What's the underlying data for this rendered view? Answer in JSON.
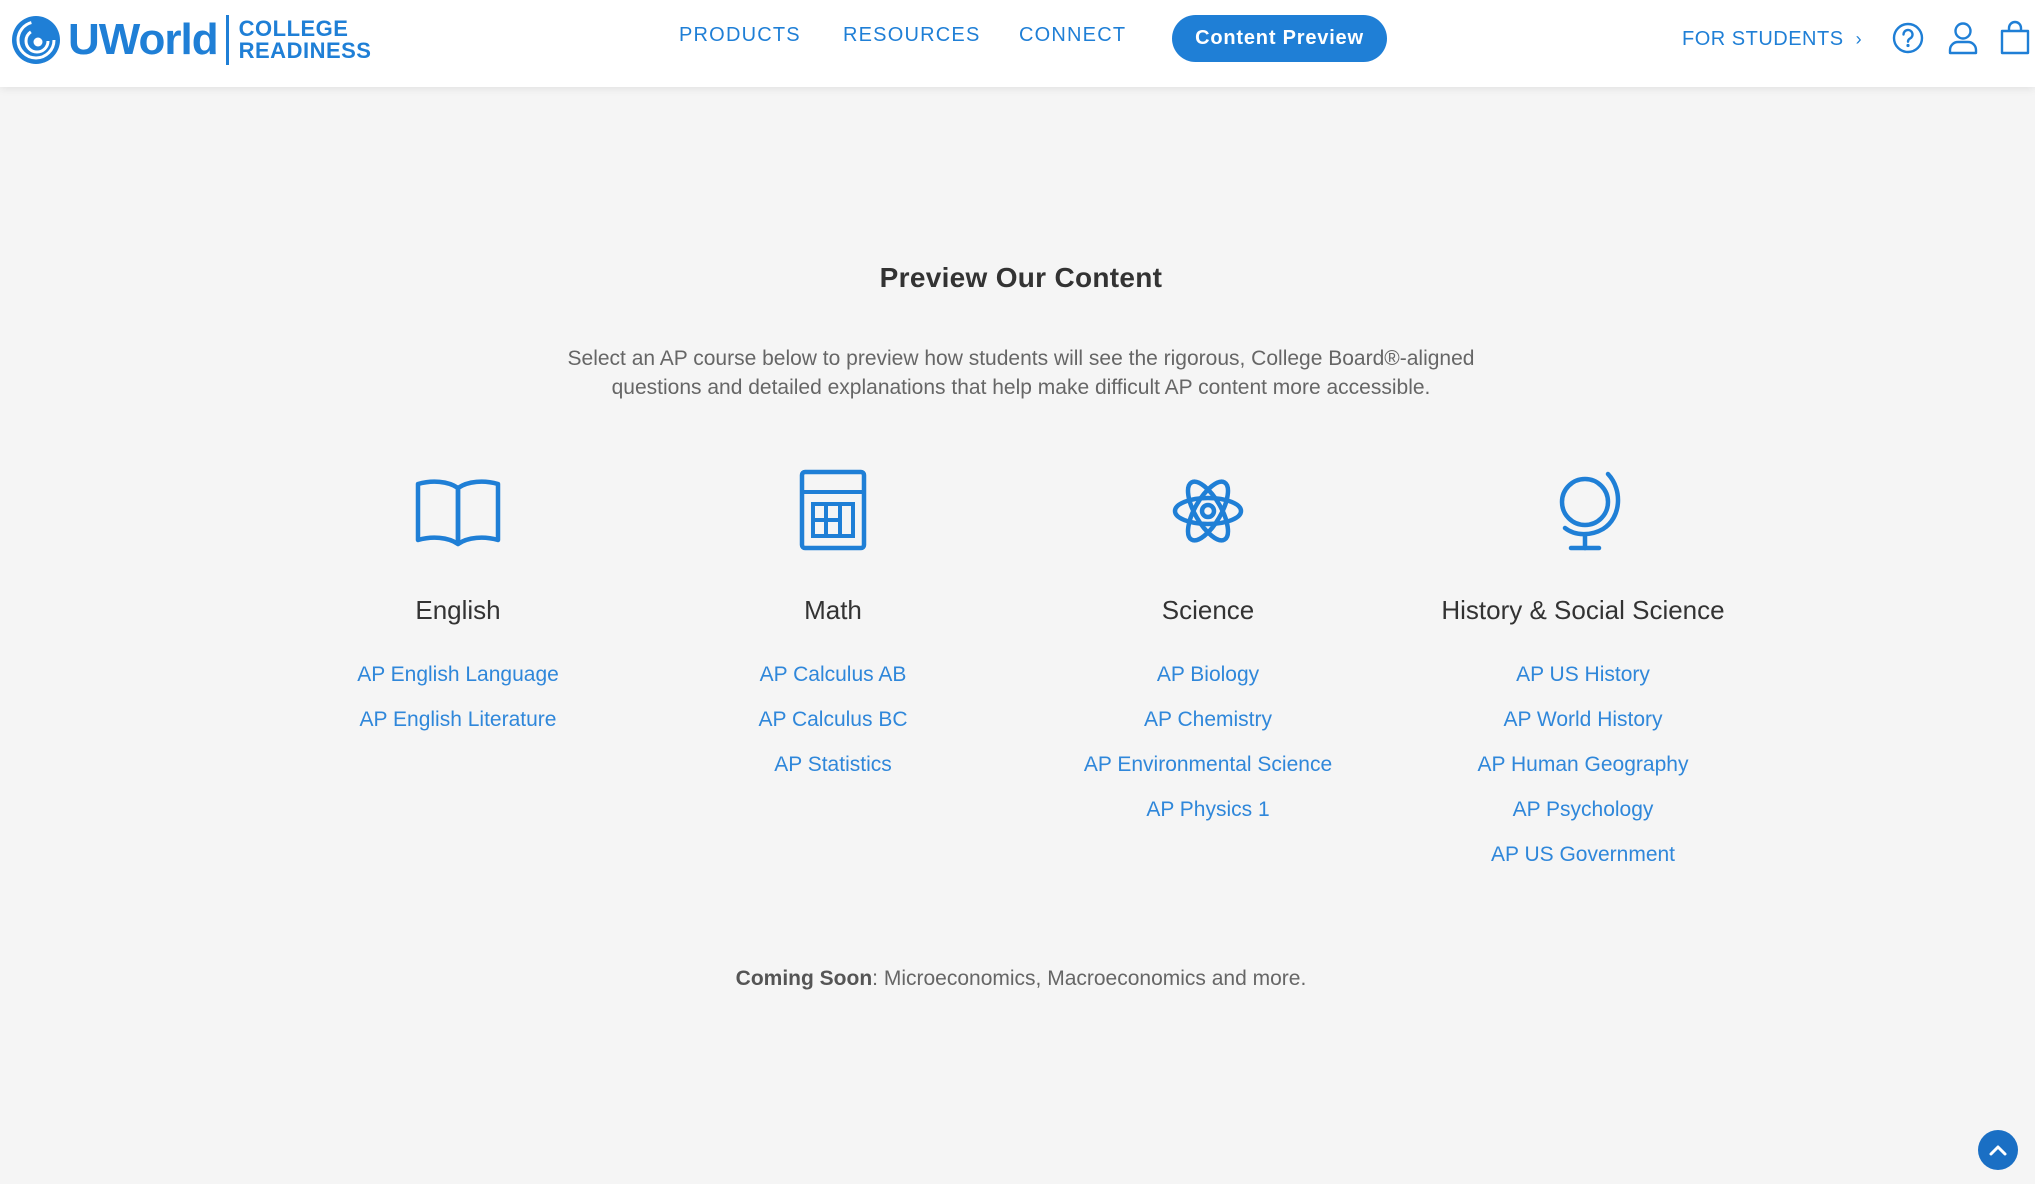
{
  "brand": {
    "name": "UWorld",
    "sub_line1": "COLLEGE",
    "sub_line2": "READINESS"
  },
  "nav": {
    "products": "PRODUCTS",
    "resources": "RESOURCES",
    "connect": "CONNECT",
    "cta": "Content Preview",
    "for_students": "FOR STUDENTS",
    "for_students_chevron": "›"
  },
  "header_icons": [
    "help-icon",
    "user-icon",
    "cart-icon"
  ],
  "content": {
    "title": "Preview Our Content",
    "description": "Select an AP course below to preview how students will see the rigorous, College Board®-aligned questions and detailed explanations that help make difficult AP content more accessible.",
    "coming_soon_label": "Coming Soon",
    "coming_soon_text": ": Microeconomics, Macroeconomics and more."
  },
  "categories": [
    {
      "icon": "open-book-icon",
      "title": "English",
      "courses": [
        "AP English Language",
        "AP English Literature"
      ]
    },
    {
      "icon": "calculator-icon",
      "title": "Math",
      "courses": [
        "AP Calculus AB",
        "AP Calculus BC",
        "AP Statistics"
      ]
    },
    {
      "icon": "atom-icon",
      "title": "Science",
      "courses": [
        "AP Biology",
        "AP Chemistry",
        "AP Environmental Science",
        "AP Physics 1"
      ]
    },
    {
      "icon": "globe-icon",
      "title": "History & Social Science",
      "courses": [
        "AP US History",
        "AP World History",
        "AP Human Geography",
        "AP Psychology",
        "AP US Government"
      ]
    }
  ],
  "colors": {
    "brand_blue": "#1f7fd6",
    "link_blue": "#2f87da",
    "background": "#f5f5f5",
    "header_bg": "#ffffff"
  },
  "scroll_top_icon": "chevron-up-icon"
}
